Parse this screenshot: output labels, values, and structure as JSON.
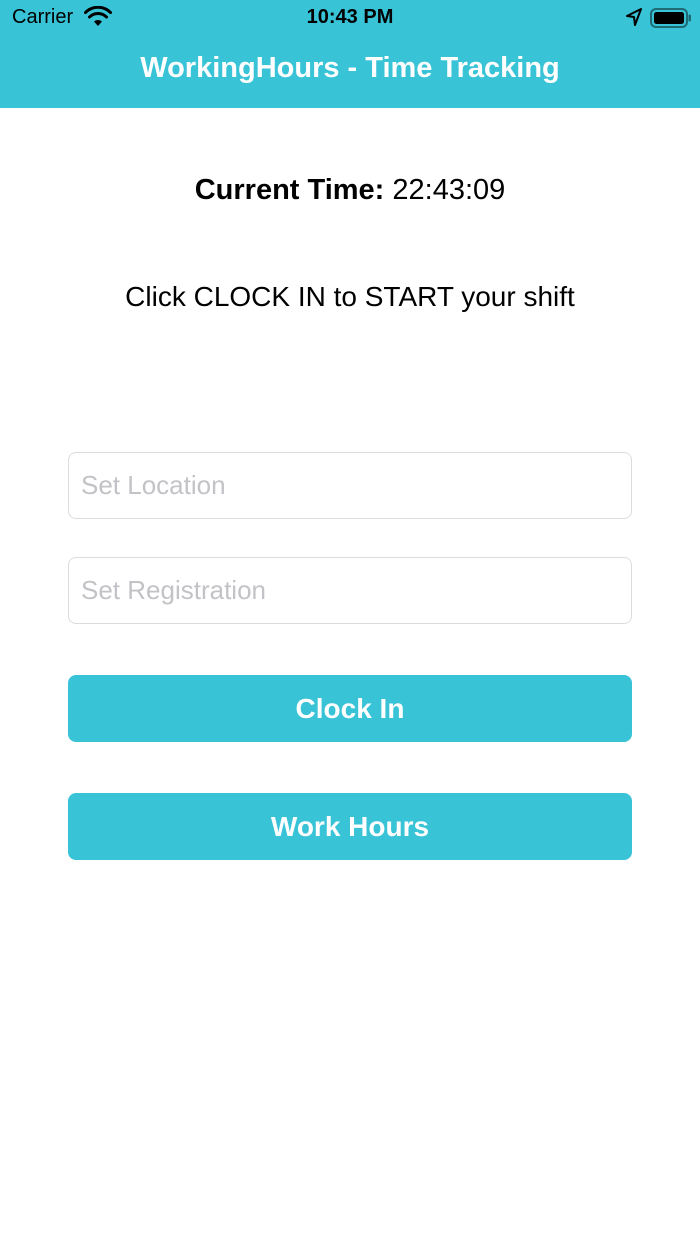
{
  "status_bar": {
    "carrier": "Carrier",
    "time": "10:43 PM",
    "icons": [
      "wifi-icon",
      "location-arrow-icon",
      "battery-icon"
    ]
  },
  "nav": {
    "title": "WorkingHours - Time Tracking"
  },
  "main": {
    "current_time_label": "Current Time:",
    "current_time_value": "22:43:09",
    "instruction": "Click CLOCK IN to START your shift",
    "location_placeholder": "Set Location",
    "registration_placeholder": "Set Registration",
    "clock_in_label": "Clock In",
    "work_hours_label": "Work Hours"
  },
  "colors": {
    "accent": "#38c3d7",
    "placeholder": "#c3c3c7"
  }
}
